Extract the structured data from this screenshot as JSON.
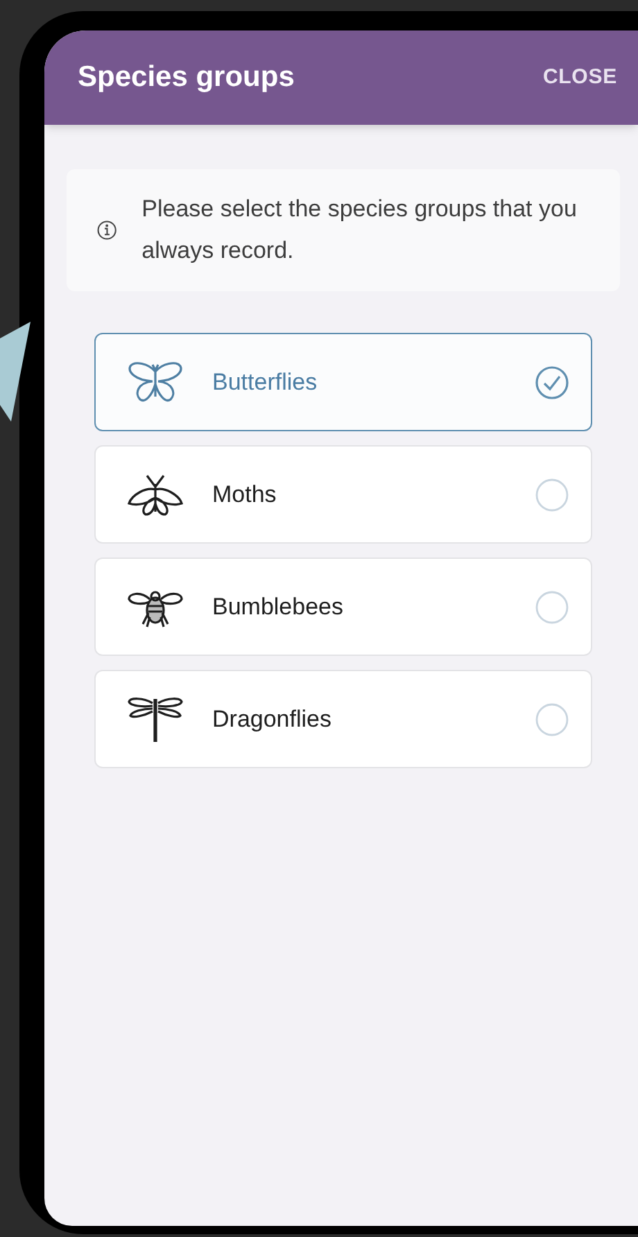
{
  "header": {
    "title": "Species groups",
    "close": "CLOSE"
  },
  "info": {
    "text": "Please select the species groups that you always record."
  },
  "groups": [
    {
      "label": "Butterflies",
      "selected": true
    },
    {
      "label": "Moths",
      "selected": false
    },
    {
      "label": "Bumblebees",
      "selected": false
    },
    {
      "label": "Dragonflies",
      "selected": false
    }
  ]
}
